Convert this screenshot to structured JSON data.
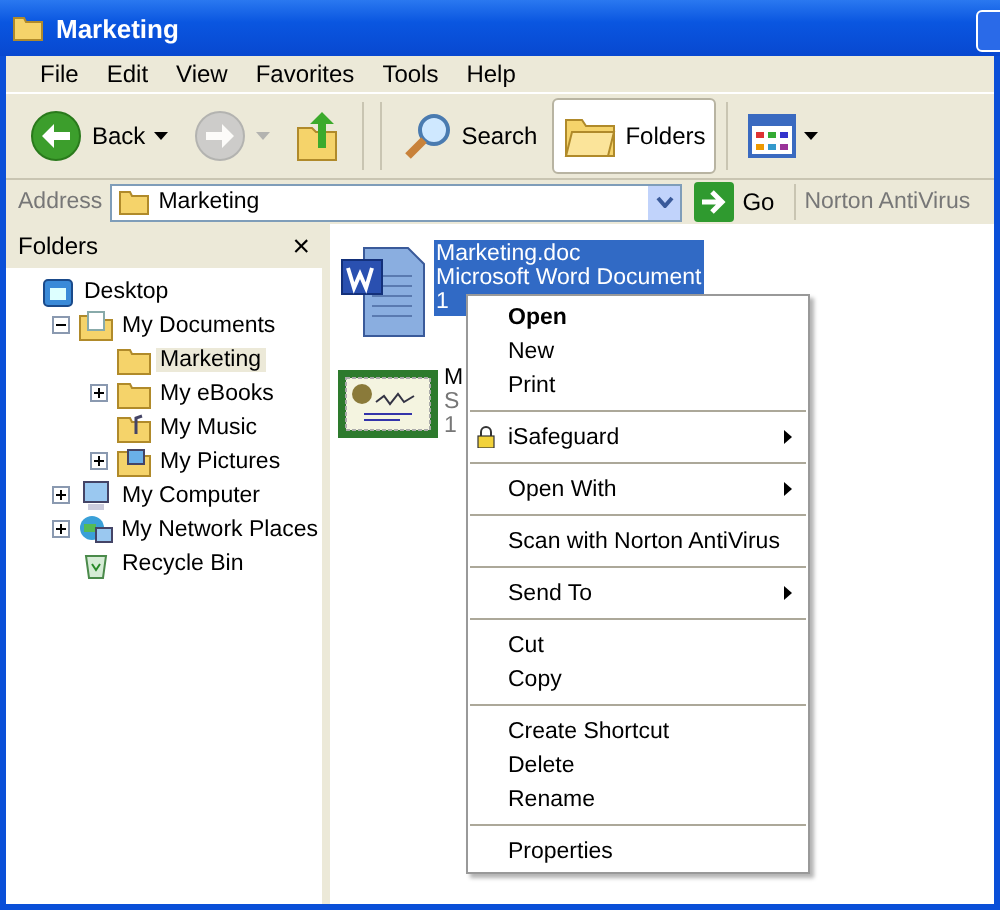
{
  "window": {
    "title": "Marketing"
  },
  "menu_bar": [
    "File",
    "Edit",
    "View",
    "Favorites",
    "Tools",
    "Help"
  ],
  "toolbar": [
    {
      "kind": "back",
      "label": "Back",
      "disabled": false,
      "dropdown": true,
      "selected": false
    },
    {
      "kind": "forward",
      "disabled": true,
      "dropdown": true,
      "selected": false
    },
    {
      "kind": "up",
      "disabled": false,
      "dropdown": false,
      "selected": false
    },
    {
      "kind": "search",
      "label": "Search",
      "disabled": false,
      "dropdown": false,
      "selected": false
    },
    {
      "kind": "folders",
      "label": "Folders",
      "disabled": false,
      "dropdown": false,
      "selected": true
    },
    {
      "kind": "views",
      "disabled": false,
      "dropdown": true,
      "selected": false
    }
  ],
  "address_bar": {
    "label": "Address",
    "value": "Marketing",
    "go": "Go",
    "links": "Norton AntiVirus"
  },
  "folders_pane": {
    "title": "Folders",
    "close": "×",
    "tree": [
      {
        "kind": "desktop",
        "label": "Desktop",
        "selected": false,
        "children": [
          {
            "kind": "documents",
            "label": "My Documents",
            "expanded": true,
            "selected": false,
            "children": [
              {
                "kind": "folder",
                "label": "Marketing",
                "selected": true
              },
              {
                "kind": "folder",
                "label": "My eBooks",
                "expanded": false,
                "selected": false
              },
              {
                "kind": "music",
                "label": "My Music",
                "selected": false
              },
              {
                "kind": "pictures",
                "label": "My Pictures",
                "expanded": false,
                "selected": false
              }
            ]
          },
          {
            "kind": "computer",
            "label": "My Computer",
            "expanded": false,
            "selected": false
          },
          {
            "kind": "network",
            "label": "My Network Places",
            "expanded": false,
            "selected": false
          },
          {
            "kind": "recycle",
            "label": "Recycle Bin",
            "selected": false
          }
        ]
      }
    ]
  },
  "files": [
    {
      "kind": "document",
      "selected": true,
      "lines": [
        "Marketing.doc",
        "Microsoft Word Document",
        "1"
      ]
    },
    {
      "kind": "certificate",
      "selected": false,
      "lines": [
        "M",
        "S",
        "1"
      ]
    }
  ],
  "context_menu": [
    {
      "kind": "item",
      "label": "Open",
      "default": true,
      "submenu": false,
      "icon": false
    },
    {
      "kind": "item",
      "label": "New",
      "default": false,
      "submenu": false,
      "icon": false
    },
    {
      "kind": "item",
      "label": "Print",
      "default": false,
      "submenu": false,
      "icon": false
    },
    {
      "kind": "separator"
    },
    {
      "kind": "item",
      "label": "iSafeguard",
      "default": false,
      "submenu": true,
      "icon": true
    },
    {
      "kind": "separator"
    },
    {
      "kind": "item",
      "label": "Open With",
      "default": false,
      "submenu": true,
      "icon": false
    },
    {
      "kind": "separator"
    },
    {
      "kind": "item",
      "label": "Scan with Norton AntiVirus",
      "default": false,
      "submenu": false,
      "icon": false
    },
    {
      "kind": "separator"
    },
    {
      "kind": "item",
      "label": "Send To",
      "default": false,
      "submenu": true,
      "icon": false
    },
    {
      "kind": "separator"
    },
    {
      "kind": "item",
      "label": "Cut",
      "default": false,
      "submenu": false,
      "icon": false
    },
    {
      "kind": "item",
      "label": "Copy",
      "default": false,
      "submenu": false,
      "icon": false
    },
    {
      "kind": "separator"
    },
    {
      "kind": "item",
      "label": "Create Shortcut",
      "default": false,
      "submenu": false,
      "icon": false
    },
    {
      "kind": "item",
      "label": "Delete",
      "default": false,
      "submenu": false,
      "icon": false
    },
    {
      "kind": "item",
      "label": "Rename",
      "default": false,
      "submenu": false,
      "icon": false
    },
    {
      "kind": "separator"
    },
    {
      "kind": "item",
      "label": "Properties",
      "default": false,
      "submenu": false,
      "icon": false
    }
  ]
}
